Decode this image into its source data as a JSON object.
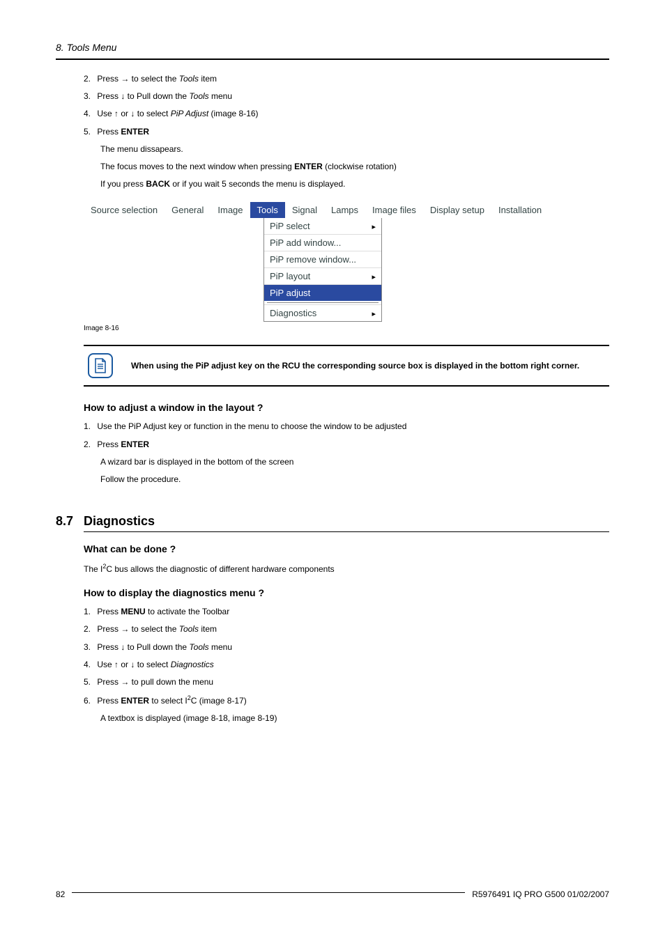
{
  "header": {
    "title": "8. Tools Menu"
  },
  "steps_top": {
    "s2_pre": "Press → to select the ",
    "s2_em": "Tools",
    "s2_post": " item",
    "s3_pre": "Press ↓ to Pull down the ",
    "s3_em": "Tools",
    "s3_post": " menu",
    "s4_pre": "Use ↑ or ↓ to select ",
    "s4_em": "PiP Adjust",
    "s4_post": " (image 8-16)",
    "s5_pre": "Press ",
    "s5_bold": "ENTER",
    "s5_sub1": "The menu dissapears.",
    "s5_sub2_pre": "The focus moves to the next window when pressing ",
    "s5_sub2_bold": "ENTER",
    "s5_sub2_post": " (clockwise rotation)",
    "s5_sub3_pre": "If you press ",
    "s5_sub3_bold": "BACK",
    "s5_sub3_post": " or if you wait 5 seconds the menu is displayed."
  },
  "nums": {
    "n2": "2.",
    "n3": "3.",
    "n4": "4.",
    "n5": "5.",
    "n6": "6.",
    "n1": "1."
  },
  "menubar": {
    "items": [
      "Source selection",
      "General",
      "Image",
      "Tools",
      "Signal",
      "Lamps",
      "Image files",
      "Display setup",
      "Installation"
    ]
  },
  "dropdown": {
    "i0": "PiP select",
    "i1": "PiP add window...",
    "i2": "PiP remove window...",
    "i3": "PiP layout",
    "i4": "PiP adjust",
    "i5": "Diagnostics"
  },
  "caption": "Image 8-16",
  "note": "When using the PiP adjust key on the RCU the corresponding source box is displayed in the bottom right corner.",
  "subheading1": "How to adjust a window in the layout ?",
  "adjust": {
    "s1": "Use the PiP Adjust key or function in the menu to choose the window to be adjusted",
    "s2_pre": "Press ",
    "s2_bold": "ENTER",
    "s2_sub1": "A wizard bar is displayed in the bottom of the screen",
    "s2_sub2": "Follow the procedure."
  },
  "section": {
    "num": "8.7",
    "title": "Diagnostics"
  },
  "diag_sub1": "What can be done ?",
  "diag_p1_a": "The I",
  "diag_p1_b": "C bus allows the diagnostic of different hardware components",
  "diag_sub2": "How to display the diagnostics menu ?",
  "diag": {
    "s1_pre": "Press ",
    "s1_bold": "MENU",
    "s1_post": " to activate the Toolbar",
    "s2_pre": "Press → to select the ",
    "s2_em": "Tools",
    "s2_post": " item",
    "s3_pre": "Press ↓ to Pull down the ",
    "s3_em": "Tools",
    "s3_post": " menu",
    "s4_pre": "Use ↑ or ↓ to select ",
    "s4_em": "Diagnostics",
    "s5": "Press → to pull down the menu",
    "s6_pre": "Press ",
    "s6_bold": "ENTER",
    "s6_mid": " to select I",
    "s6_post": "C (image 8-17)",
    "s6_sub": "A textbox is displayed (image 8-18, image 8-19)"
  },
  "footer": {
    "page": "82",
    "doc": "R5976491  IQ PRO G500  01/02/2007"
  }
}
